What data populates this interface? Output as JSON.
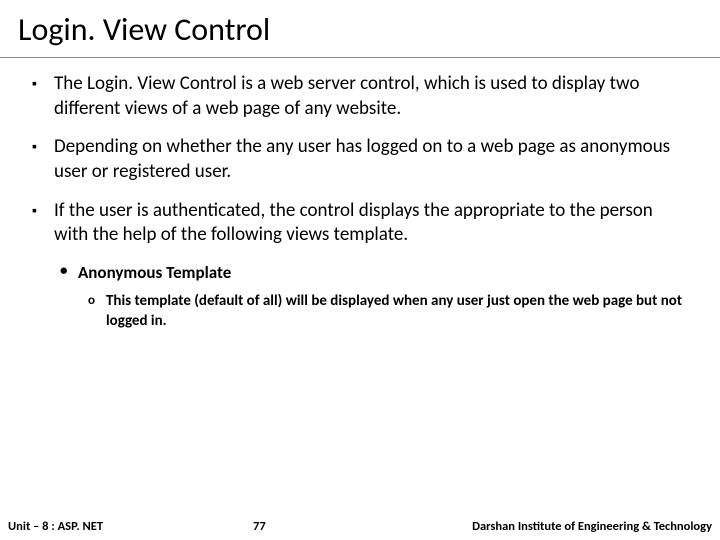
{
  "title": "Login. View Control",
  "bullets": [
    {
      "level": 1,
      "text": "The Login. View Control is a web server control, which is used to display two different views of a web page of any website."
    },
    {
      "level": 1,
      "text": "Depending on whether the any user has logged on to a web page as anonymous user or registered user."
    },
    {
      "level": 1,
      "text": "If the user is authenticated, the control displays the appropriate to the person with the help of the following views template."
    },
    {
      "level": 2,
      "text": "Anonymous Template"
    },
    {
      "level": 3,
      "text": "This template (default of all) will be displayed when any user just open the web page but not logged in."
    }
  ],
  "footer": {
    "left": "Unit – 8 : ASP. NET",
    "center": "77",
    "right": "Darshan Institute of Engineering & Technology"
  }
}
